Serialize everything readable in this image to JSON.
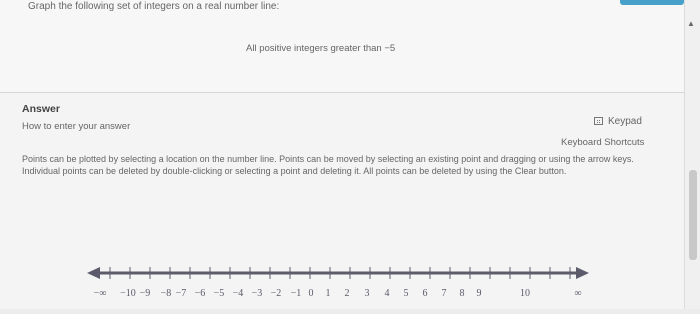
{
  "header": {
    "question": "Graph the following set of integers on a real number line:",
    "statement": "All positive integers greater than −5"
  },
  "answer": {
    "title": "Answer",
    "how_to_label": "How to enter your answer",
    "keypad_label": "Keypad",
    "keypad_icon": "keypad-icon",
    "shortcuts_label": "Keyboard Shortcuts",
    "instructions": "Points can be plotted by selecting a location on the number line. Points can be moved by selecting an existing point and dragging or using the arrow keys. Individual points can be deleted by double-clicking or selecting a point and deleting it. All points can be deleted by using the Clear button."
  },
  "number_line": {
    "labels": [
      "−∞",
      "−10",
      "−9",
      "−8",
      "−7",
      "−6",
      "−5",
      "−4",
      "−3",
      "−2",
      "−1",
      "0",
      "1",
      "2",
      "3",
      "4",
      "5",
      "6",
      "7",
      "8",
      "9",
      "10",
      "∞"
    ]
  },
  "colors": {
    "line": "#5b5b6b",
    "scroll_accent": "#46a0c9"
  }
}
